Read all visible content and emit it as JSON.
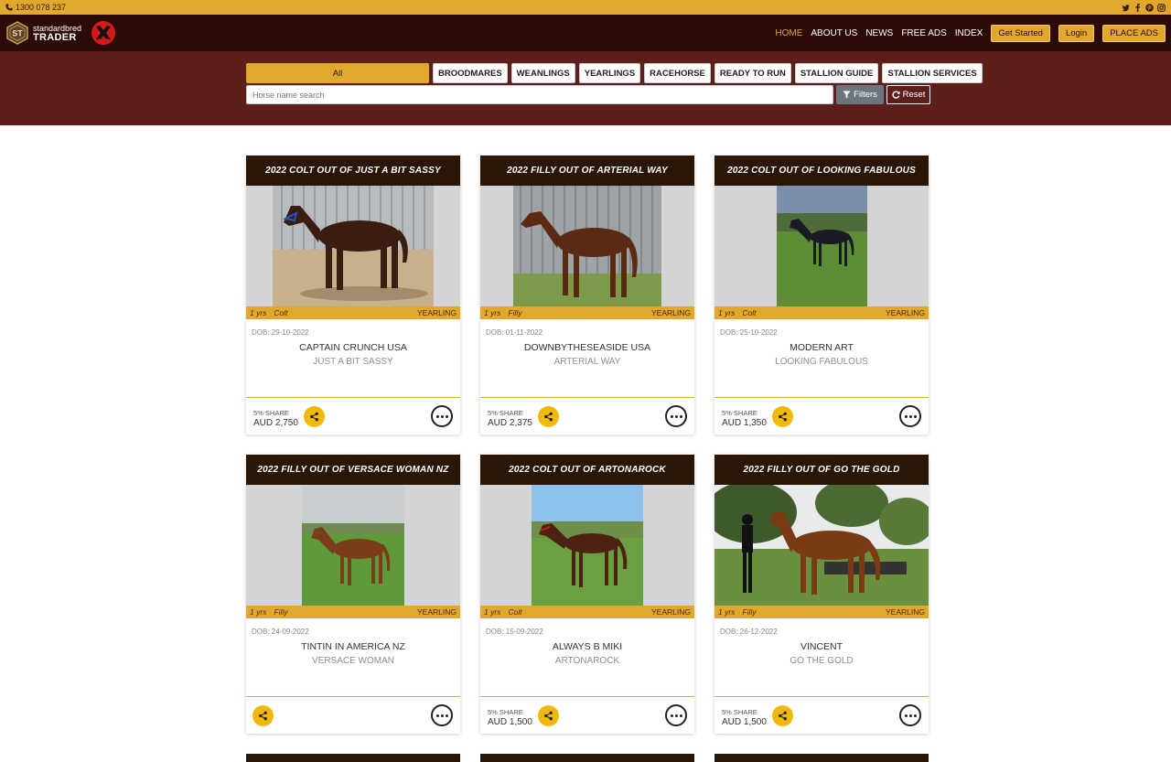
{
  "topbar": {
    "phone": "1300 078 237",
    "socials": [
      "twitter-icon",
      "facebook-icon",
      "pinterest-icon",
      "instagram-icon"
    ]
  },
  "brand": {
    "line1": "standardbred",
    "line2": "TRADER",
    "logo_initials": "ST"
  },
  "nav": {
    "items": [
      {
        "label": "HOME",
        "active": true
      },
      {
        "label": "ABOUT US"
      },
      {
        "label": "NEWS"
      },
      {
        "label": "FREE ADS"
      },
      {
        "label": "INDEX"
      }
    ],
    "get_started": "Get Started",
    "login": "Login",
    "place_ads": "PLACE ADS"
  },
  "filters": {
    "tabs": [
      "All",
      "BROODMARES",
      "WEANLINGS",
      "YEARLINGS",
      "RACEHORSE",
      "READY TO RUN",
      "STALLION GUIDE",
      "STALLION SERVICES"
    ],
    "search_placeholder": "Horse name search",
    "filters_label": "Filters",
    "reset_label": "Reset"
  },
  "colors": {
    "gold": "#e2a82d",
    "nav_dark": "#2c0a08",
    "band": "#5c1f1c",
    "card_header": "#2a1606"
  },
  "listings": [
    {
      "title": "2022 COLT OUT OF JUST A BIT SASSY",
      "age": "1 yrs",
      "sex": "Colt",
      "category": "YEARLING",
      "dob": "DOB: 29-10-2022",
      "sire": "CAPTAIN CRUNCH USA",
      "dam": "JUST A BIT SASSY",
      "share": "5% SHARE",
      "price": "AUD 2,750"
    },
    {
      "title": "2022 FILLY OUT OF ARTERIAL WAY",
      "age": "1 yrs",
      "sex": "Filly",
      "category": "YEARLING",
      "dob": "DOB: 01-11-2022",
      "sire": "DOWNBYTHESEASIDE USA",
      "dam": "ARTERIAL WAY",
      "share": "5% SHARE",
      "price": "AUD 2,375"
    },
    {
      "title": "2022 COLT OUT OF LOOKING FABULOUS",
      "age": "1 yrs",
      "sex": "Colt",
      "category": "YEARLING",
      "dob": "DOB: 25-10-2022",
      "sire": "MODERN ART",
      "dam": "LOOKING FABULOUS",
      "share": "5% SHARE",
      "price": "AUD 1,350"
    },
    {
      "title": "2022 FILLY OUT OF VERSACE WOMAN NZ",
      "age": "1 yrs",
      "sex": "Filly",
      "category": "YEARLING",
      "dob": "DOB: 24-09-2022",
      "sire": "TINTIN IN AMERICA NZ",
      "dam": "VERSACE WOMAN",
      "share": "",
      "price": ""
    },
    {
      "title": "2022 COLT OUT OF ARTONAROCK",
      "age": "1 yrs",
      "sex": "Colt",
      "category": "YEARLING",
      "dob": "DOB: 15-09-2022",
      "sire": "ALWAYS B MIKI",
      "dam": "ARTONAROCK",
      "share": "5% SHARE",
      "price": "AUD 1,500"
    },
    {
      "title": "2022 FILLY OUT OF GO THE GOLD",
      "age": "1 yrs",
      "sex": "Filly",
      "category": "YEARLING",
      "dob": "DOB: 26-12-2022",
      "sire": "VINCENT",
      "dam": "GO THE GOLD",
      "share": "5% SHARE",
      "price": "AUD 1,500"
    }
  ]
}
